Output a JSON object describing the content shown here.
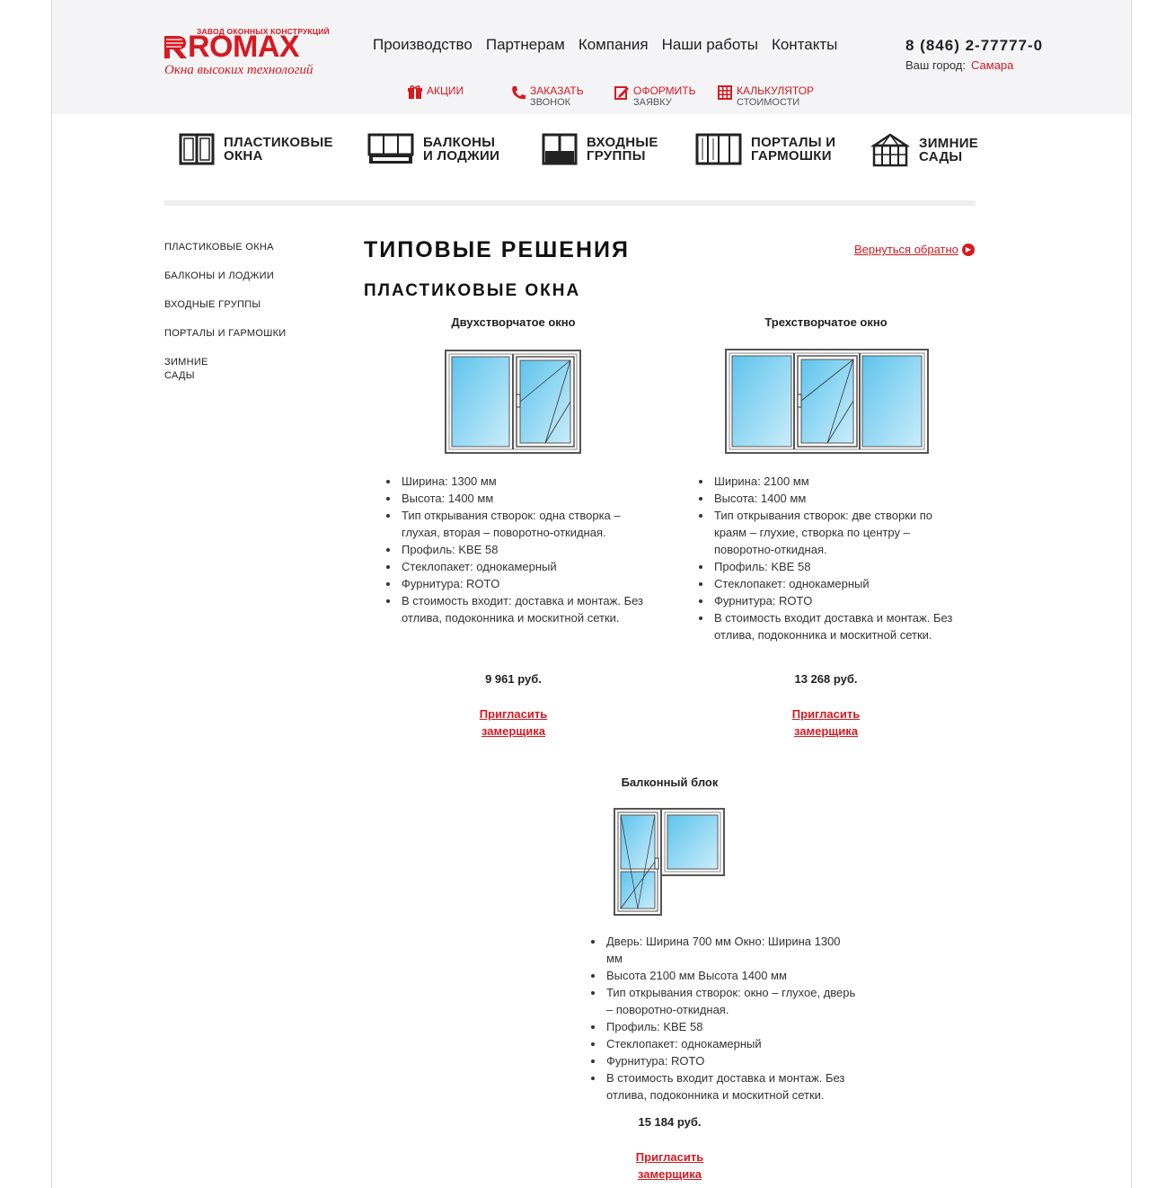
{
  "logo": {
    "top_text": "ЗАВОД ОКОННЫХ КОНСТРУКЦИЙ",
    "brand": "ROMAX",
    "slogan": "Окна высоких технологий"
  },
  "top_nav": [
    "Производство",
    "Партнерам",
    "Компания",
    "Наши работы",
    "Контакты"
  ],
  "contact": {
    "phone": "8 (846) 2-77777-0",
    "city_label": "Ваш город:",
    "city": "Самара"
  },
  "actions": [
    {
      "line1": "АКЦИИ",
      "line2": "",
      "icon": "gift-icon"
    },
    {
      "line1": "ЗАКАЗАТЬ",
      "line2": "ЗВОНОК",
      "icon": "phone-icon"
    },
    {
      "line1": "ОФОРМИТЬ",
      "line2": "ЗАЯВКУ",
      "icon": "form-icon"
    },
    {
      "line1": "КАЛЬКУЛЯТОР",
      "line2": "СТОИМОСТИ",
      "icon": "calculator-icon"
    }
  ],
  "categories": [
    {
      "label": "ПЛАСТИКОВЫЕ\nОКНА",
      "icon": "window-icon"
    },
    {
      "label": "БАЛКОНЫ\nИ ЛОДЖИИ",
      "icon": "balcony-icon"
    },
    {
      "label": "ВХОДНЫЕ\nГРУППЫ",
      "icon": "entrance-icon"
    },
    {
      "label": "ПОРТАЛЫ И\nГАРМОШКИ",
      "icon": "portal-icon"
    },
    {
      "label": "ЗИМНИЕ\nСАДЫ",
      "icon": "winter-garden-icon"
    }
  ],
  "side_menu": [
    "ПЛАСТИКОВЫЕ ОКНА",
    "БАЛКОНЫ И ЛОДЖИИ",
    "ВХОДНЫЕ ГРУППЫ",
    "ПОРТАЛЫ И ГАРМОШКИ",
    "ЗИМНИЕ\nСАДЫ"
  ],
  "main": {
    "title": "ТИПОВЫЕ РЕШЕНИЯ",
    "back_link": "Вернуться обратно",
    "section": "ПЛАСТИКОВЫЕ ОКНА"
  },
  "products": [
    {
      "name": "Двухстворчатое окно",
      "specs": [
        "Ширина: 1300 мм",
        "Высота: 1400 мм",
        "Тип открывания створок: одна створка – глухая, вторая – поворотно-откидная.",
        "Профиль: KBE 58",
        "Стеклопакет: однокамерный",
        "Фурнитура: ROTO",
        "В стоимость входит: доставка и монтаж. Без отлива, подоконника и москитной сетки."
      ],
      "price": "9 961 руб.",
      "cta": [
        "Пригласить",
        "замерщика"
      ]
    },
    {
      "name": "Трехстворчатое окно",
      "specs": [
        "Ширина: 2100 мм",
        "Высота: 1400 мм",
        "Тип открывания створок: две створки по краям – глухие, створка по центру – поворотно-откидная.",
        "Профиль: KBE 58",
        "Стеклопакет: однокамерный",
        "Фурнитура: ROTO",
        "В стоимость входит доставка и монтаж. Без отлива, подоконника и москитной сетки."
      ],
      "price": "13 268 руб.",
      "cta": [
        "Пригласить",
        "замерщика"
      ]
    },
    {
      "name": "Балконный блок",
      "specs": [
        "Дверь: Ширина 700 мм Окно: Ширина 1300 мм",
        "Высота 2100 мм Высота 1400 мм",
        "Тип открывания створок: окно – глухое, дверь – поворотно-откидная.",
        "Профиль: KBE 58",
        "Стеклопакет: однокамерный",
        "Фурнитура: ROTO",
        "В стоимость входит доставка и монтаж. Без отлива, подоконника и москитной сетки."
      ],
      "price": "15 184 руб.",
      "cta": [
        "Пригласить",
        "замерщика"
      ]
    }
  ],
  "colors": {
    "accent": "#d71920",
    "glass": "#7fd0f0",
    "header_bg": "#f4f4f6"
  }
}
